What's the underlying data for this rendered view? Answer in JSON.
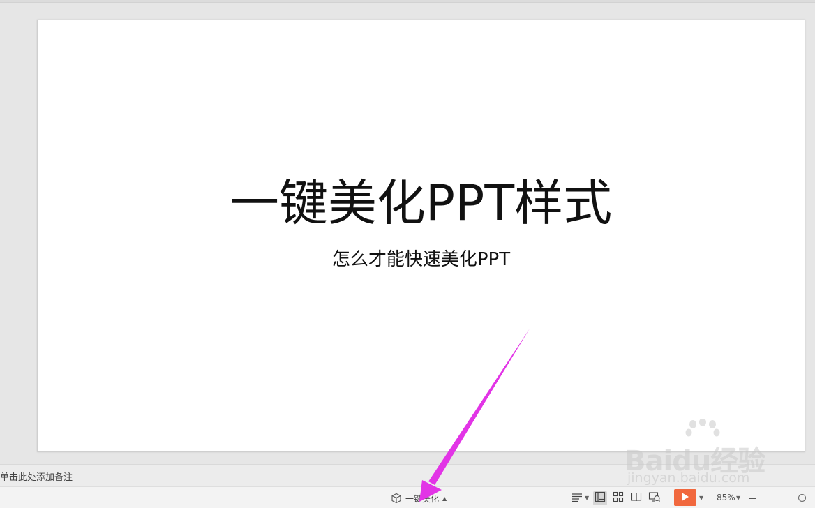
{
  "slide": {
    "title": "一键美化PPT样式",
    "subtitle": "怎么才能快速美化PPT"
  },
  "notes": {
    "placeholder": "单击此处添加备注"
  },
  "status_bar": {
    "beautify_label": "一键美化",
    "beautify_icon": "cube-icon",
    "notes_toggle_icon": "notes-list-icon",
    "views": [
      {
        "name": "normal-view",
        "icon": "normal-view-icon",
        "active": true
      },
      {
        "name": "slide-sorter-view",
        "icon": "grid-view-icon",
        "active": false
      },
      {
        "name": "reading-view",
        "icon": "book-icon",
        "active": false
      },
      {
        "name": "presenter-view",
        "icon": "presenter-view-icon",
        "active": false
      }
    ],
    "play_icon": "play-icon",
    "play_color": "#f1683e",
    "zoom_label": "85%",
    "zoom_level": 0.85
  },
  "annotation": {
    "arrow_color": "#e234e6"
  },
  "watermark": {
    "brand": "Baidu经验",
    "url": "jingyan.baidu.com"
  }
}
